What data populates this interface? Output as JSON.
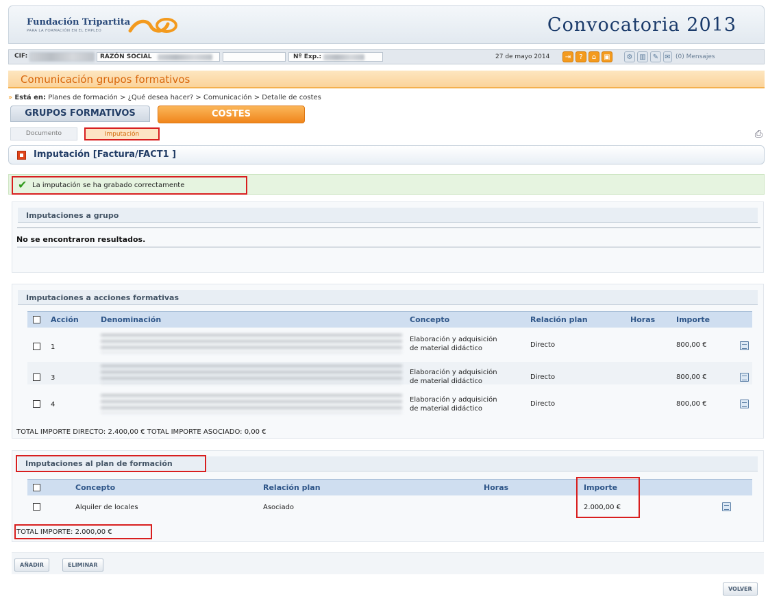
{
  "header": {
    "brand": "Fundación Tripartita",
    "brand_sub": "PARA LA FORMACIÓN EN EL EMPLEO",
    "convocatoria": "Convocatoria 2013"
  },
  "infobar": {
    "cif_label": "CIF:",
    "razon_label": "RAZÓN SOCIAL",
    "exp_label": "Nº Exp.:",
    "date": "27 de mayo 2014",
    "messages": "(0) Mensajes"
  },
  "page_title": "Comunicación grupos formativos",
  "breadcrumb": {
    "prefix": "Está en:",
    "path": "Planes de formación > ¿Qué desea hacer? > Comunicación > Detalle de costes"
  },
  "tabs": {
    "grupos": "GRUPOS FORMATIVOS",
    "costes": "COSTES"
  },
  "subtabs": {
    "documento": "Documento",
    "imputacion": "Imputación"
  },
  "section_title": "Imputación [Factura/FACT1 ]",
  "success_message": "La imputación se ha grabado correctamente",
  "panel_grupo": {
    "title": "Imputaciones a grupo",
    "empty": "No se encontraron resultados."
  },
  "panel_acciones": {
    "title": "Imputaciones a acciones formativas",
    "columns": [
      "Acción",
      "Denominación",
      "Concepto",
      "Relación plan",
      "Horas",
      "Importe"
    ],
    "rows": [
      {
        "accion": "1",
        "concepto_1": "Elaboración y adquisición",
        "concepto_2": "de material didáctico",
        "relacion": "Directo",
        "horas": "",
        "importe": "800,00 €"
      },
      {
        "accion": "3",
        "concepto_1": "Elaboración y adquisición",
        "concepto_2": "de material didáctico",
        "relacion": "Directo",
        "horas": "",
        "importe": "800,00 €"
      },
      {
        "accion": "4",
        "concepto_1": "Elaboración y adquisición",
        "concepto_2": "de material didáctico",
        "relacion": "Directo",
        "horas": "",
        "importe": "800,00 €"
      }
    ],
    "totals": "TOTAL IMPORTE DIRECTO: 2.400,00 € TOTAL IMPORTE ASOCIADO: 0,00 €"
  },
  "panel_plan": {
    "title": "Imputaciones al plan de formación",
    "columns": [
      "Concepto",
      "Relación plan",
      "Horas",
      "Importe"
    ],
    "rows": [
      {
        "concepto": "Alquiler de locales",
        "relacion": "Asociado",
        "horas": "",
        "importe": "2.000,00 €"
      }
    ],
    "totals": "TOTAL IMPORTE: 2.000,00 €"
  },
  "buttons": {
    "add": "AÑADIR",
    "delete": "ELIMINAR",
    "back": "VOLVER"
  },
  "colors": {
    "accent_orange": "#f0861c",
    "highlight_red": "#d81e1e",
    "success_green": "#2f9a1a"
  }
}
